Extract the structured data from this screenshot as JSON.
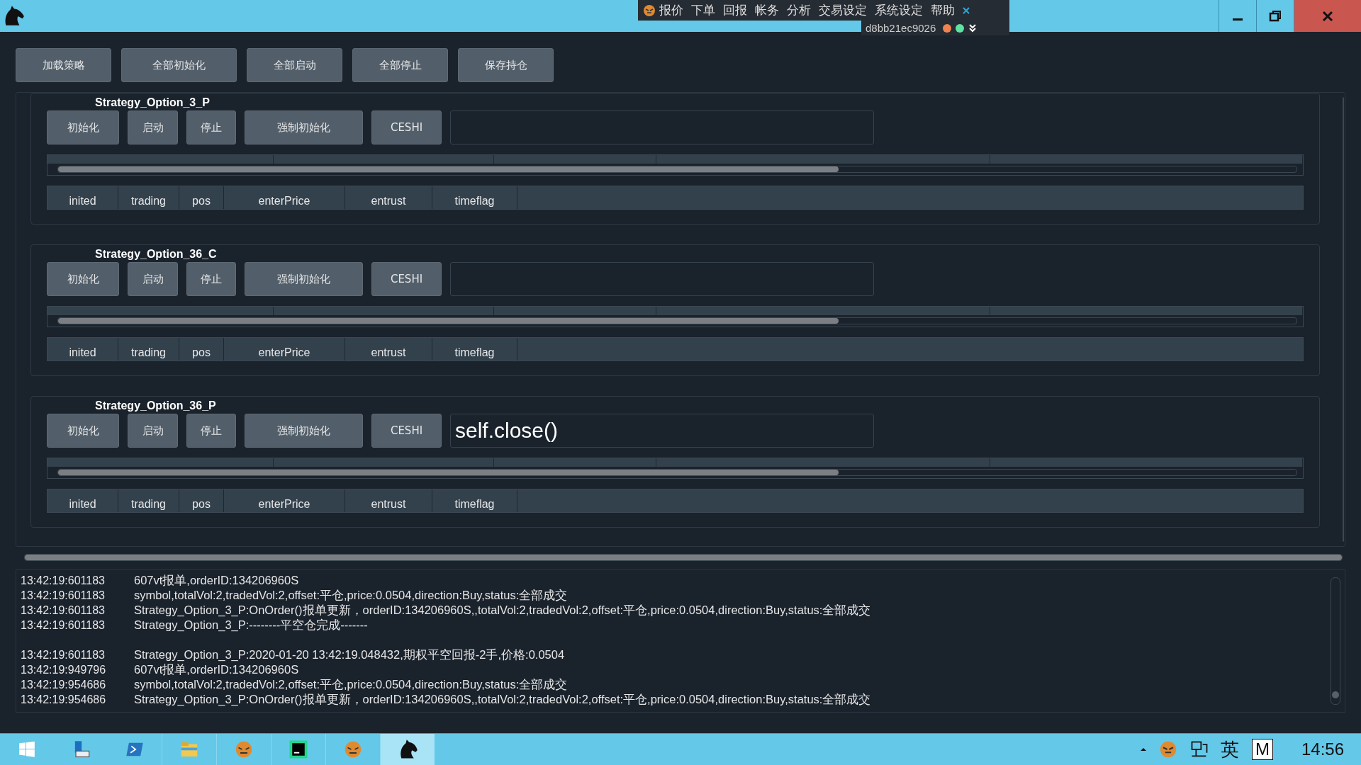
{
  "menu": {
    "items": [
      "报价",
      "下单",
      "回报",
      "帐务",
      "分析",
      "交易设定",
      "系统设定",
      "帮助"
    ],
    "account": "d8bb21ec9026",
    "indicators": [
      {
        "color": "#f0834f"
      },
      {
        "color": "#5fe3a1"
      }
    ]
  },
  "toolbar": [
    "加载策略",
    "全部初始化",
    "全部启动",
    "全部停止",
    "保存持仓"
  ],
  "strategies": [
    {
      "name": "Strategy_Option_3_P",
      "buttons": [
        "初始化",
        "启动",
        "停止",
        "强制初始化",
        "CESHI"
      ],
      "var_columns": [
        "inited",
        "trading",
        "pos",
        "enterPrice",
        "entrust",
        "timeflag"
      ]
    },
    {
      "name": "Strategy_Option_36_C",
      "buttons": [
        "初始化",
        "启动",
        "停止",
        "强制初始化",
        "CESHI"
      ],
      "var_columns": [
        "inited",
        "trading",
        "pos",
        "enterPrice",
        "entrust",
        "timeflag"
      ]
    },
    {
      "name": "Strategy_Option_36_P",
      "buttons": [
        "初始化",
        "启动",
        "停止",
        "强制初始化",
        "CESHI"
      ],
      "command": "self.close()",
      "var_columns": [
        "inited",
        "trading",
        "pos",
        "enterPrice",
        "entrust",
        "timeflag"
      ]
    }
  ],
  "log": [
    {
      "kind": "entry",
      "time": "13:42:19:601183",
      "message": "607vt报单,orderID:134206960S"
    },
    {
      "kind": "entry",
      "time": "13:42:19:601183",
      "message": "symbol,totalVol:2,tradedVol:2,offset:平仓,price:0.0504,direction:Buy,status:全部成交"
    },
    {
      "kind": "entry",
      "time": "13:42:19:601183",
      "message": "Strategy_Option_3_P:OnOrder()报单更新，orderID:134206960S,,totalVol:2,tradedVol:2,offset:平仓,price:0.0504,direction:Buy,status:全部成交"
    },
    {
      "kind": "entry",
      "time": "13:42:19:601183",
      "message": "Strategy_Option_3_P:--------平空仓完成-------"
    },
    {
      "kind": "blank"
    },
    {
      "kind": "entry",
      "time": "13:42:19:601183",
      "message": "Strategy_Option_3_P:2020-01-20 13:42:19.048432,期权平空回报-2手,价格:0.0504"
    },
    {
      "kind": "entry",
      "time": "13:42:19:949796",
      "message": "607vt报单,orderID:134206960S"
    },
    {
      "kind": "entry",
      "time": "13:42:19:954686",
      "message": "symbol,totalVol:2,tradedVol:2,offset:平仓,price:0.0504,direction:Buy,status:全部成交"
    },
    {
      "kind": "entry",
      "time": "13:42:19:954686",
      "message": "Strategy_Option_3_P:OnOrder()报单更新，orderID:134206960S,,totalVol:2,tradedVol:2,offset:平仓,price:0.0504,direction:Buy,status:全部成交"
    }
  ],
  "taskbar": {
    "apps": [
      {
        "kind": "explorer",
        "selected": false
      },
      {
        "kind": "tiger",
        "selected": false
      },
      {
        "kind": "pycharm",
        "selected": false
      },
      {
        "kind": "tiger",
        "selected": false
      },
      {
        "kind": "horse",
        "selected": true
      }
    ],
    "tray": [
      "英",
      "M"
    ],
    "clock": "14:56"
  }
}
